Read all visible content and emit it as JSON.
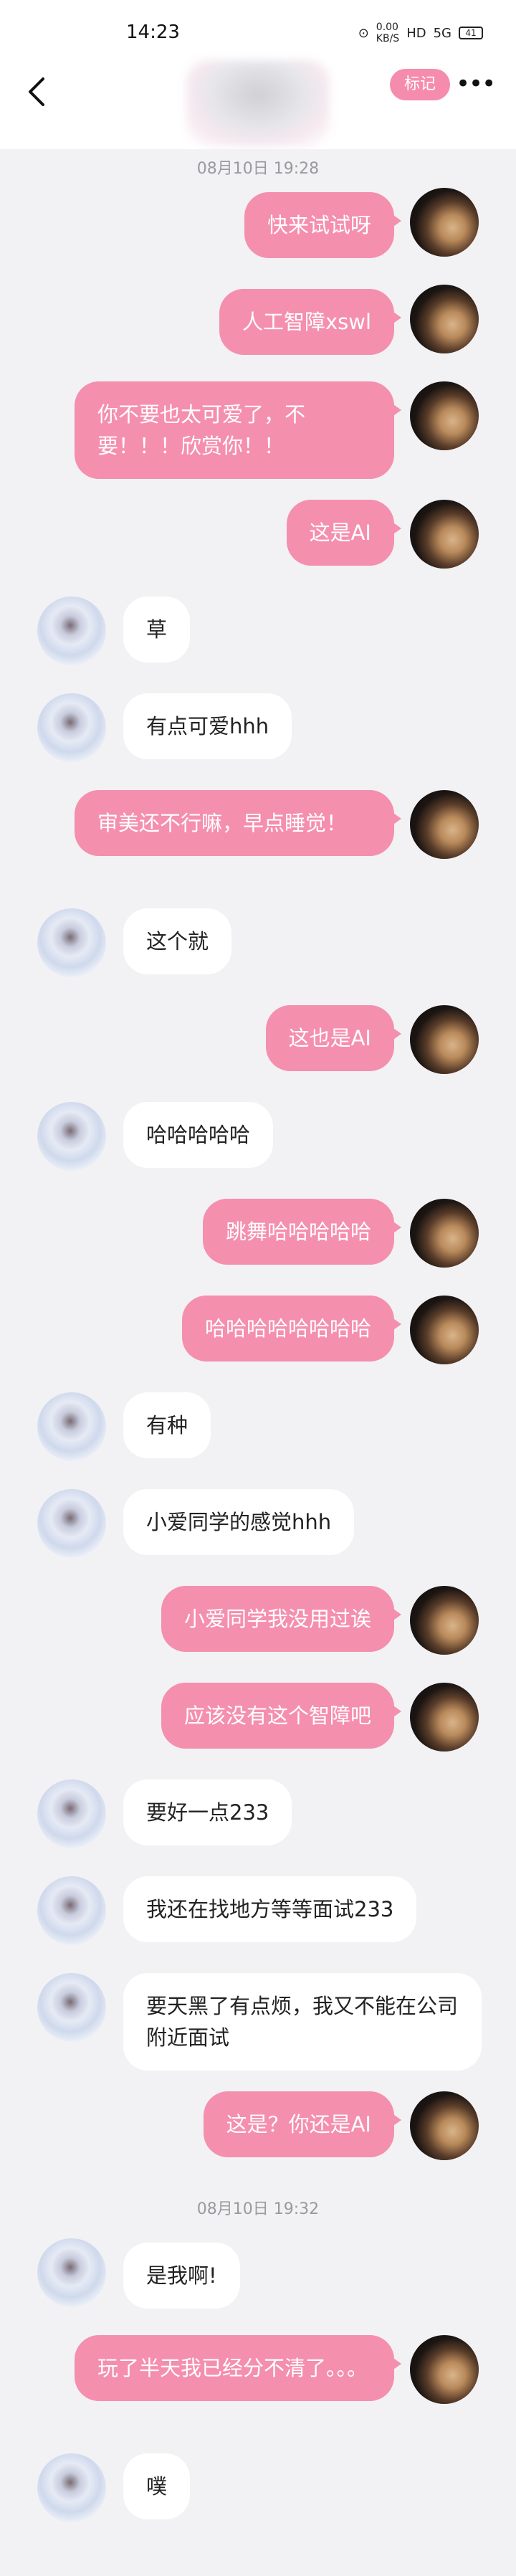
{
  "status_bar": {
    "time": "14:23",
    "speed": "0.00",
    "speed_unit": "KB/S",
    "hd": "HD",
    "signal": "5G",
    "battery": "41"
  },
  "header": {
    "remark_label": "标记",
    "more_label": "•••"
  },
  "chat": {
    "timestamps": [
      "08月10日 19:28",
      "08月10日 19:32"
    ],
    "messages": [
      {
        "side": "self",
        "text": "快来试试呀"
      },
      {
        "side": "self",
        "text": "人工智障xswl"
      },
      {
        "side": "self",
        "text": "你不要也太可爱了，不要！！！欣赏你！！"
      },
      {
        "side": "self",
        "text": "这是AI"
      },
      {
        "side": "other",
        "text": "草"
      },
      {
        "side": "other",
        "text": "有点可爱hhh"
      },
      {
        "side": "self",
        "text": "审美还不行嘛，早点睡觉！"
      },
      {
        "side": "other",
        "text": "这个就"
      },
      {
        "side": "self",
        "text": "这也是AI"
      },
      {
        "side": "other",
        "text": "哈哈哈哈哈"
      },
      {
        "side": "self",
        "text": "跳舞哈哈哈哈哈"
      },
      {
        "side": "self",
        "text": "哈哈哈哈哈哈哈哈"
      },
      {
        "side": "other",
        "text": "有种"
      },
      {
        "side": "other",
        "text": "小爱同学的感觉hhh"
      },
      {
        "side": "self",
        "text": "小爱同学我没用过诶"
      },
      {
        "side": "self",
        "text": "应该没有这个智障吧"
      },
      {
        "side": "other",
        "text": "要好一点233"
      },
      {
        "side": "other",
        "text": "我还在找地方等等面试233"
      },
      {
        "side": "other",
        "text": "要天黑了有点烦，我又不能在公司附近面试"
      },
      {
        "side": "self",
        "text": "这是？你还是AI"
      },
      {
        "side": "other",
        "text": "是我啊!"
      },
      {
        "side": "self",
        "text": "玩了半天我已经分不清了。。。"
      },
      {
        "side": "other",
        "text": "噗"
      }
    ]
  }
}
